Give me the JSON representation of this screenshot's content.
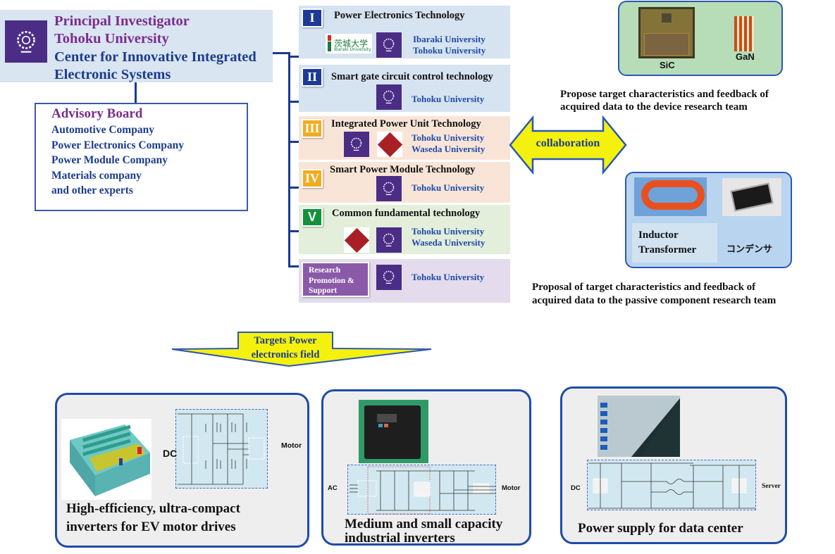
{
  "principal": {
    "line1": "Principal Investigator",
    "line2": "Tohoku University",
    "line3": "Center for Innovative Integrated",
    "line4": "Electronic Systems",
    "logo": "tohoku-university-logo"
  },
  "advisory_board": {
    "title": "Advisory Board",
    "members": [
      "Automotive Company",
      "Power Electronics Company",
      "Power Module Company",
      "Materials company",
      "and other experts"
    ]
  },
  "research_groups": [
    {
      "numeral": "I",
      "title": "Power Electronics Technology",
      "universities": [
        "Ibaraki University",
        "Tohoku University"
      ],
      "color": "#1c3a96"
    },
    {
      "numeral": "II",
      "title": "Smart gate circuit control technology",
      "universities": [
        "Tohoku University"
      ],
      "color": "#1c3a96"
    },
    {
      "numeral": "III",
      "title": "Integrated Power Unit Technology",
      "universities": [
        "Tohoku University",
        "Waseda University"
      ],
      "color": "#f1ad1f"
    },
    {
      "numeral": "IV",
      "title": "Smart Power Module Technology",
      "universities": [
        "Tohoku University"
      ],
      "color": "#f1ad1f"
    },
    {
      "numeral": "V",
      "title": "Common fundamental technology",
      "universities": [
        "Tohoku University",
        "Waseda University"
      ],
      "color": "#12923a"
    },
    {
      "numeral": "",
      "title": "Research Promotion & Support",
      "title_lines": [
        "Research",
        "Promotion &",
        "Support"
      ],
      "universities": [
        "Tohoku University"
      ],
      "color": "#8a5aa8"
    }
  ],
  "logos": {
    "ibaraki_text": "茨城大学",
    "ibaraki_sub": "Ibaraki University"
  },
  "collaboration": {
    "label": "collaboration"
  },
  "device_team": {
    "items": [
      "SiC",
      "GaN"
    ],
    "caption_line1": "Propose target characteristics and  feedback of",
    "caption_line2": "acquired data to the device research team"
  },
  "passive_team": {
    "item1_line1": "Inductor",
    "item1_line2": "Transformer",
    "item2": "コンデンサ",
    "caption_line1": "Proposal of target characteristics and feedback of",
    "caption_line2": "acquired data to the passive component research team"
  },
  "targets_arrow": {
    "line1": "Targets Power",
    "line2": "electronics field"
  },
  "applications": [
    {
      "title_line1": "High-efficiency, ultra-compact",
      "title_line2": "inverters for EV motor drives",
      "input": "DC",
      "output": "Motor"
    },
    {
      "title_line1": "Medium and small capacity",
      "title_line2": "industrial inverters",
      "input": "AC",
      "output": "Motor"
    },
    {
      "title_line1": "Power supply for data center",
      "title_line2": "",
      "input": "DC",
      "output": "Server"
    }
  ]
}
